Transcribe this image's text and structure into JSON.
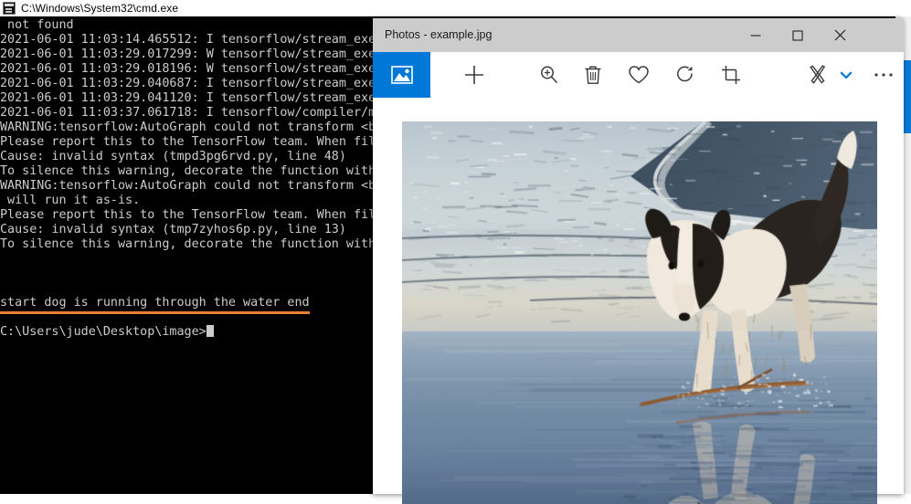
{
  "cmd_window": {
    "title": "C:\\Windows\\System32\\cmd.exe",
    "icon": "console-icon",
    "console_lines": [
      " not found",
      "2021-06-01 11:03:14.465512: I tensorflow/stream_exe",
      "2021-06-01 11:03:29.017299: W tensorflow/stream_exe",
      "2021-06-01 11:03:29.018196: W tensorflow/stream_exe",
      "2021-06-01 11:03:29.040687: I tensorflow/stream_exe",
      "2021-06-01 11:03:29.041120: I tensorflow/stream_exe",
      "2021-06-01 11:03:37.061718: I tensorflow/compiler/m",
      "WARNING:tensorflow:AutoGraph could not transform <b",
      "Please report this to the TensorFlow team. When fil",
      "Cause: invalid syntax (tmpd3pg6rvd.py, line 48)",
      "To silence this warning, decorate the function with",
      "WARNING:tensorflow:AutoGraph could not transform <b",
      " will run it as-is.",
      "Please report this to the TensorFlow team. When fil",
      "Cause: invalid syntax (tmp7zyhos6p.py, line 13)",
      "To silence this warning, decorate the function with"
    ],
    "highlighted_output": "start dog is running through the water end",
    "highlight_color": "#f08030",
    "prompt": "C:\\Users\\jude\\Desktop\\image>",
    "text_color": "#cccccc",
    "background_color": "#000000",
    "scrollbar": {
      "track_color": "#f0f0f0",
      "thumb_color": "#0b7ad6"
    }
  },
  "photos_window": {
    "title": "Photos - example.jpg",
    "titlebar_color": "#cccccc",
    "window_controls": [
      {
        "name": "minimize",
        "glyph": "—"
      },
      {
        "name": "maximize",
        "glyph": "□"
      },
      {
        "name": "close",
        "glyph": "✕"
      }
    ],
    "toolbar": {
      "accent_color": "#0078d7",
      "items": [
        {
          "name": "gallery-tile",
          "icon": "picture-icon",
          "label": "",
          "active": true
        },
        {
          "name": "add",
          "icon": "plus-icon",
          "label": ""
        },
        {
          "name": "zoom",
          "icon": "zoom-in-icon",
          "label": ""
        },
        {
          "name": "delete",
          "icon": "trash-icon",
          "label": ""
        },
        {
          "name": "favorite",
          "icon": "heart-icon",
          "label": ""
        },
        {
          "name": "rotate",
          "icon": "rotate-icon",
          "label": ""
        },
        {
          "name": "crop",
          "icon": "crop-icon",
          "label": ""
        },
        {
          "name": "edit-create",
          "icon": "pen-brush-icon",
          "label": ""
        },
        {
          "name": "edit-create-chevron",
          "icon": "chevron-down-icon",
          "label": ""
        },
        {
          "name": "more",
          "icon": "ellipsis-icon",
          "label": ""
        }
      ]
    },
    "photo": {
      "name": "example.jpg",
      "description": "Border collie dog running through shallow water on a beach with its reflection below"
    }
  }
}
